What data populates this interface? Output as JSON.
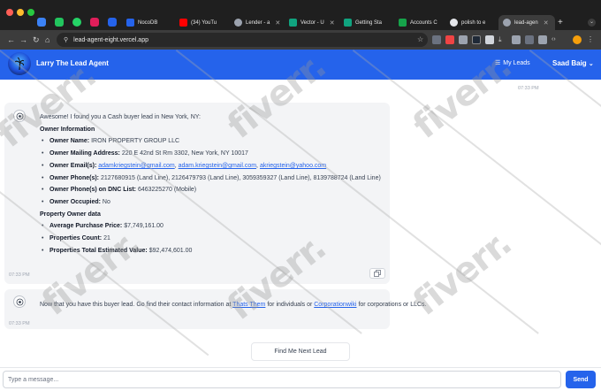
{
  "browser": {
    "tabs": [
      {
        "label": "",
        "color": "#3b82f6"
      },
      {
        "label": "",
        "color": "#22c55e"
      },
      {
        "label": "",
        "color": "#25d366"
      },
      {
        "label": "",
        "color": "#e01e5a"
      },
      {
        "label": "NocoDB",
        "color": "#2563eb"
      },
      {
        "label": "(34) YouTu",
        "color": "#ff0000"
      },
      {
        "label": "Lender - a",
        "color": "#9ca3af"
      },
      {
        "label": "Vector - U",
        "color": "#10a37f"
      },
      {
        "label": "Getting Sta",
        "color": "#10a37f"
      },
      {
        "label": "Accounts C",
        "color": "#16a34a"
      },
      {
        "label": "polish to e",
        "color": "#e5e7eb"
      },
      {
        "label": "lead-agen",
        "color": "#9ca3af"
      }
    ],
    "new_tab": "+",
    "url": "lead-agent-eight.vercel.app"
  },
  "header": {
    "title": "Larry The Lead Agent",
    "my_leads": "My Leads",
    "user": "Saad Baig"
  },
  "chat": {
    "top_timestamp": "07:33 PM",
    "message1": {
      "intro": "Awesome! I found you a Cash buyer lead in New York, NY:",
      "owner_heading": "Owner Information",
      "owner_name_label": "Owner Name:",
      "owner_name": "IRON PROPERTY GROUP LLC",
      "mailing_label": "Owner Mailing Address:",
      "mailing": "220 E 42nd St Rm 3302, New York, NY 10017",
      "emails_label": "Owner Email(s):",
      "email1": "adamkriegstein@gmail.com",
      "email2": "adam.kriegstein@gmail.com",
      "email3": "akriegstein@yahoo.com",
      "phones_label": "Owner Phone(s):",
      "phones": "2127680915 (Land Line), 2126479793 (Land Line), 3059359327 (Land Line), 8139788724 (Land Line)",
      "dnc_label": "Owner Phone(s) on DNC List:",
      "dnc": "6463225270 (Mobile)",
      "occupied_label": "Owner Occupied:",
      "occupied": "No",
      "property_heading": "Property Owner data",
      "avg_price_label": "Average Purchase Price:",
      "avg_price": "$7,749,161.00",
      "count_label": "Properties Count:",
      "count": "21",
      "total_label": "Properties Total Estimated Value:",
      "total": "$92,474,601.00",
      "timestamp": "07:33 PM"
    },
    "message2": {
      "text_a": "Now that you have this buyer lead. Go find their contact information at ",
      "link1": "Thats Them",
      "text_b": " for individuals or ",
      "link2": "Corporationwiki",
      "text_c": " for corporations or LLCs.",
      "timestamp": "07:33 PM"
    },
    "find_next_label": "Find Me Next Lead"
  },
  "composer": {
    "placeholder": "Type a message...",
    "send_label": "Send"
  },
  "watermark": "fiverr.",
  "colors": {
    "brand": "#2563eb",
    "bubble": "#f3f4f6"
  }
}
